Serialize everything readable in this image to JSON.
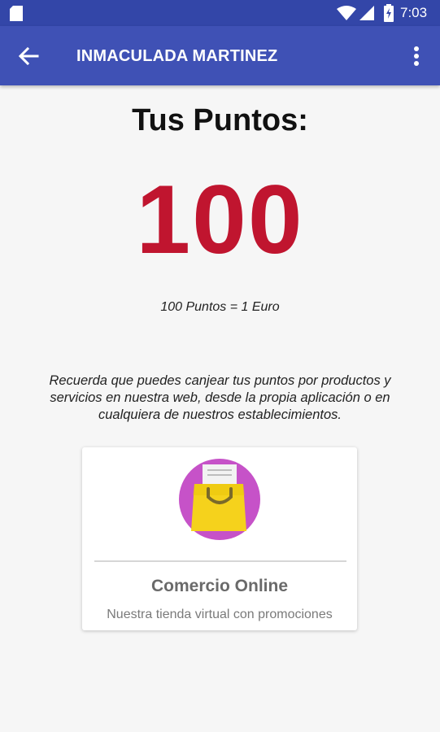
{
  "status_bar": {
    "time": "7:03"
  },
  "app_bar": {
    "title": "INMACULADA MARTINEZ"
  },
  "points": {
    "heading": "Tus Puntos:",
    "value": "100",
    "value_color": "#c0152f",
    "conversion": "100 Puntos = 1 Euro"
  },
  "info_text": "Recuerda que puedes canjear tus puntos por productos y servicios en nuestra web, desde la propia aplicación o en cualquiera de nuestros establecimientos.",
  "online_shop_card": {
    "icon": "shopping-bag-icon",
    "title": "Comercio Online",
    "subtitle": "Nuestra tienda virtual con promociones"
  },
  "colors": {
    "status_bar": "#3346a8",
    "app_bar": "#3f51b5",
    "bag_circle": "#c652c8",
    "bag": "#f5d21c"
  }
}
